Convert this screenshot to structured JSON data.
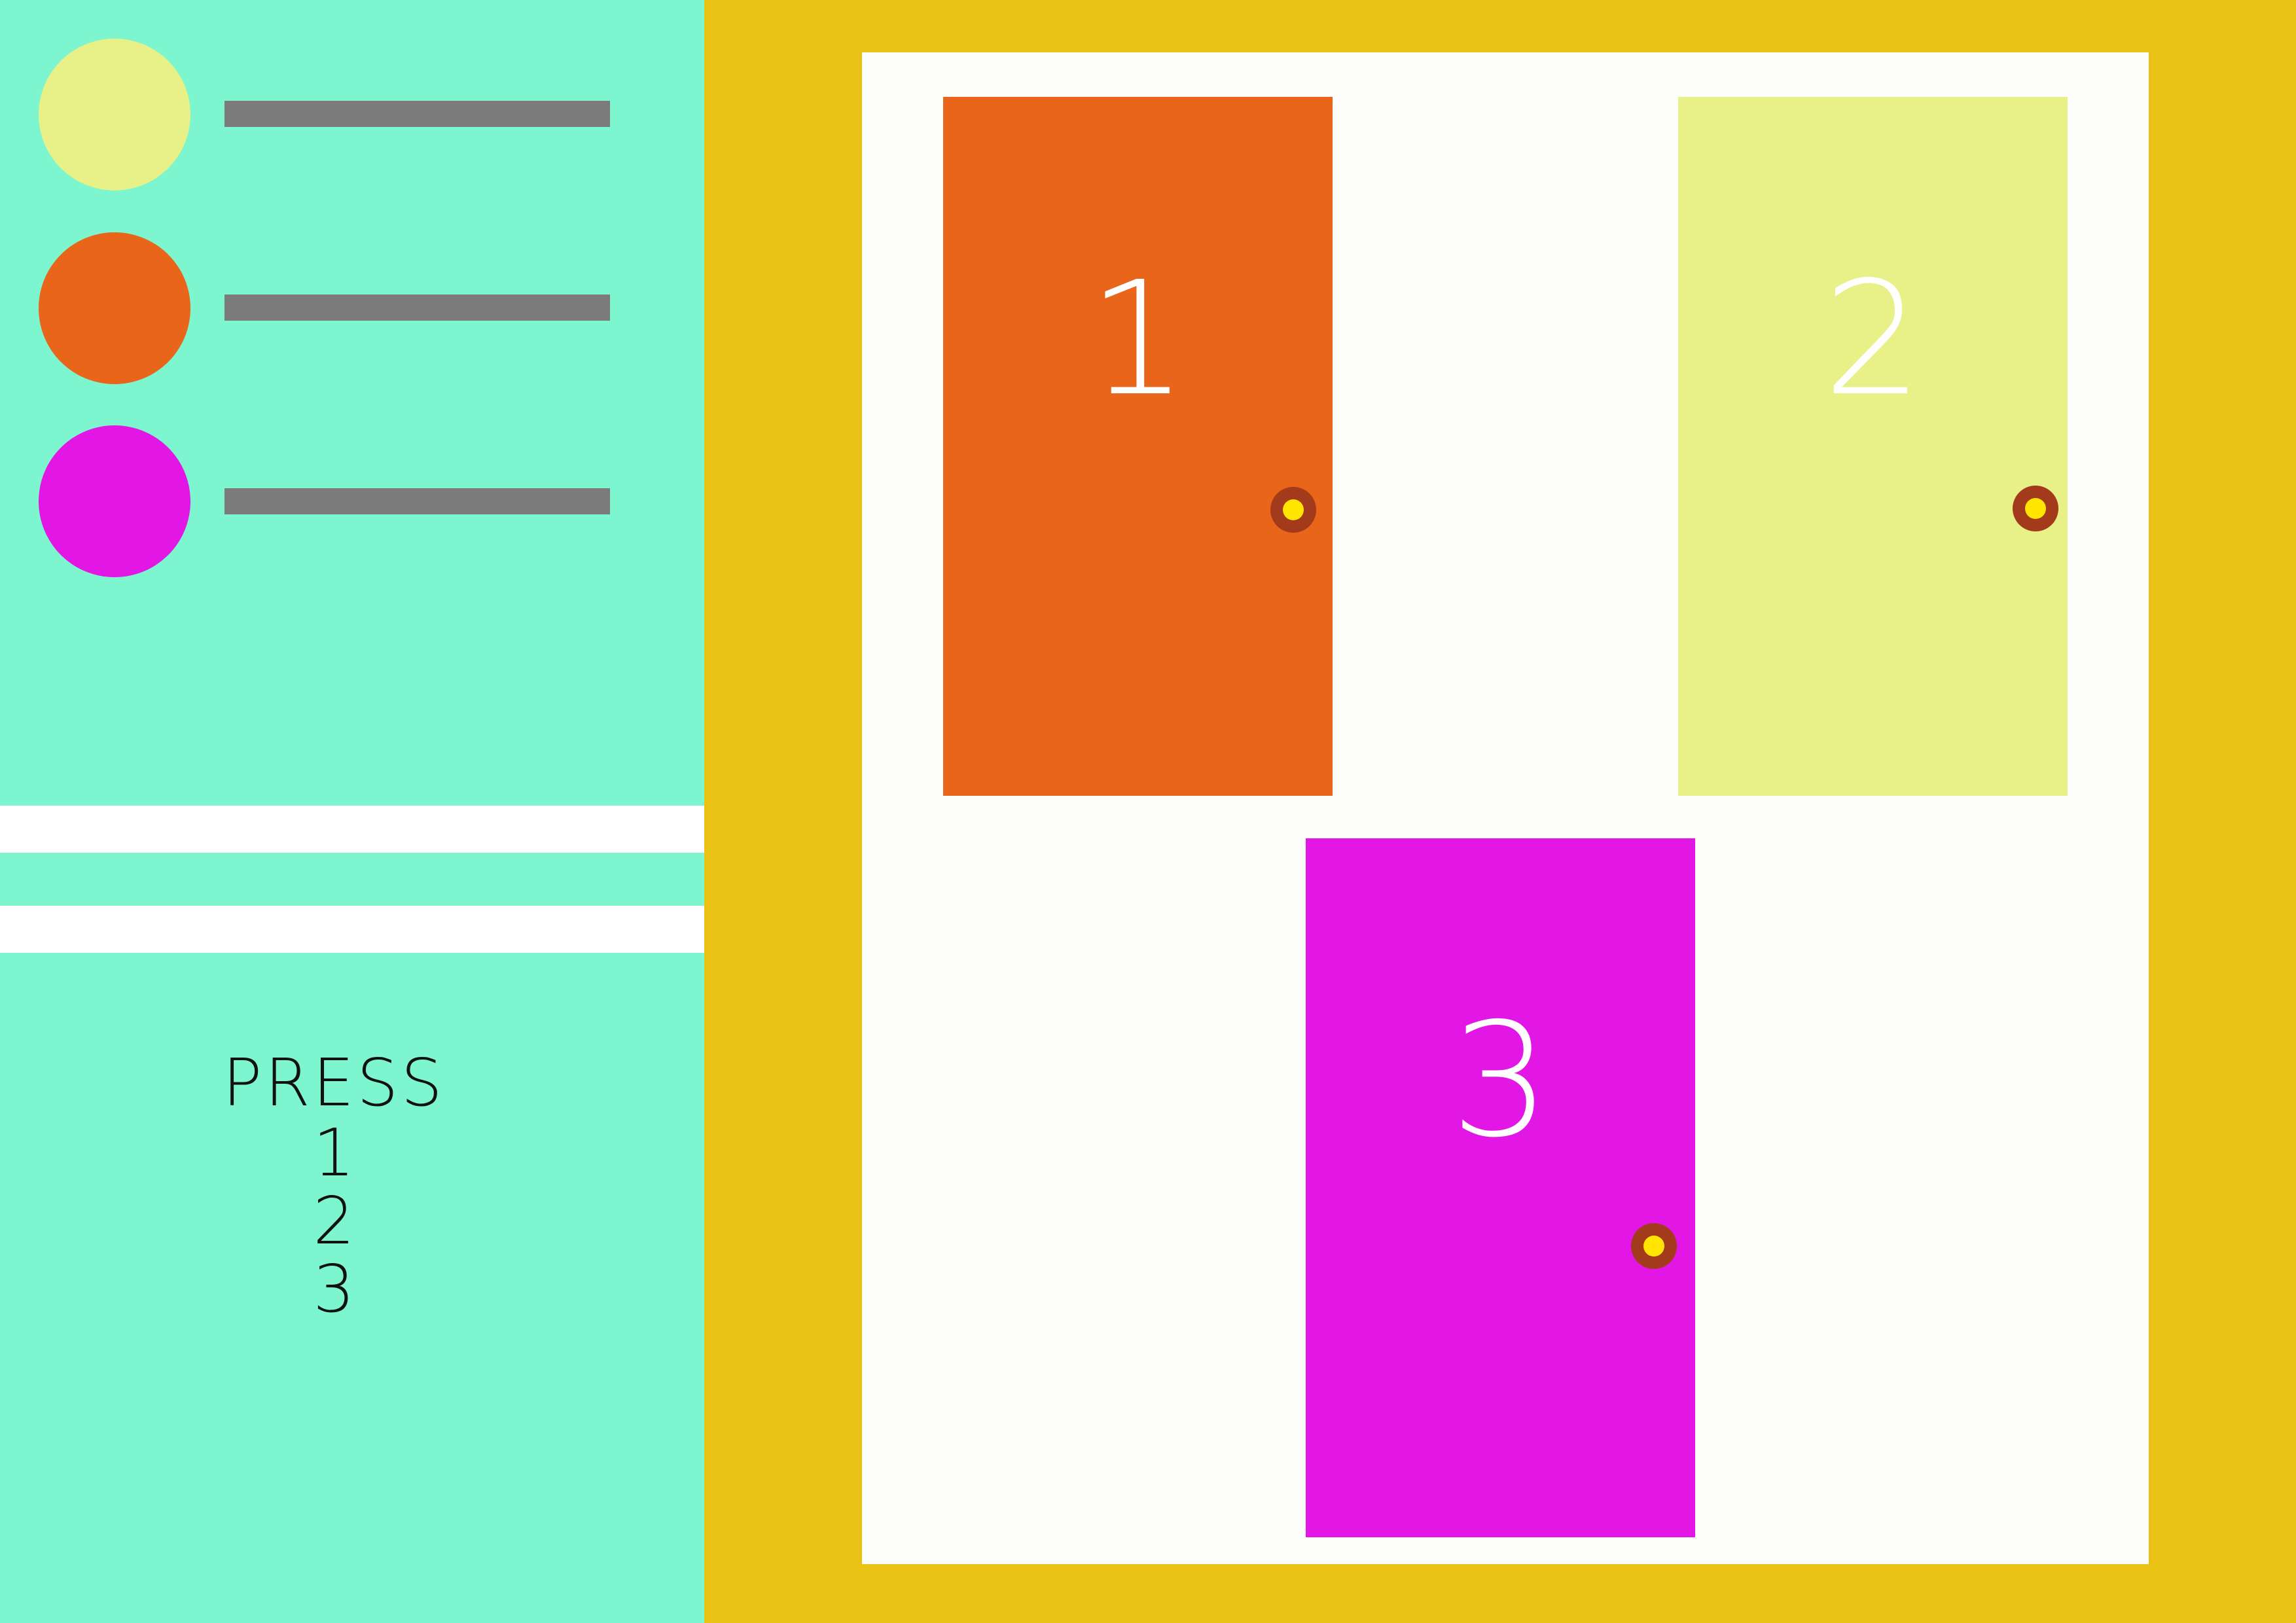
{
  "colors": {
    "left_panel": "#7df5cf",
    "right_panel": "#eac215",
    "stage": "#fdfdfc",
    "legend_bar": "#7b7b7b",
    "knob_outer": "#a33a1c",
    "knob_inner": "#ffe500"
  },
  "legend": [
    {
      "color": "#e8f188",
      "icon": "circle-swatch"
    },
    {
      "color": "#e8651a",
      "icon": "circle-swatch"
    },
    {
      "color": "#e317e5",
      "icon": "circle-swatch"
    }
  ],
  "instructions": {
    "press": "PRESS",
    "options": [
      "1",
      "2",
      "3"
    ]
  },
  "doors": [
    {
      "number": "1",
      "color": "#e8651a"
    },
    {
      "number": "2",
      "color": "#e8f188"
    },
    {
      "number": "3",
      "color": "#e317e5"
    }
  ]
}
